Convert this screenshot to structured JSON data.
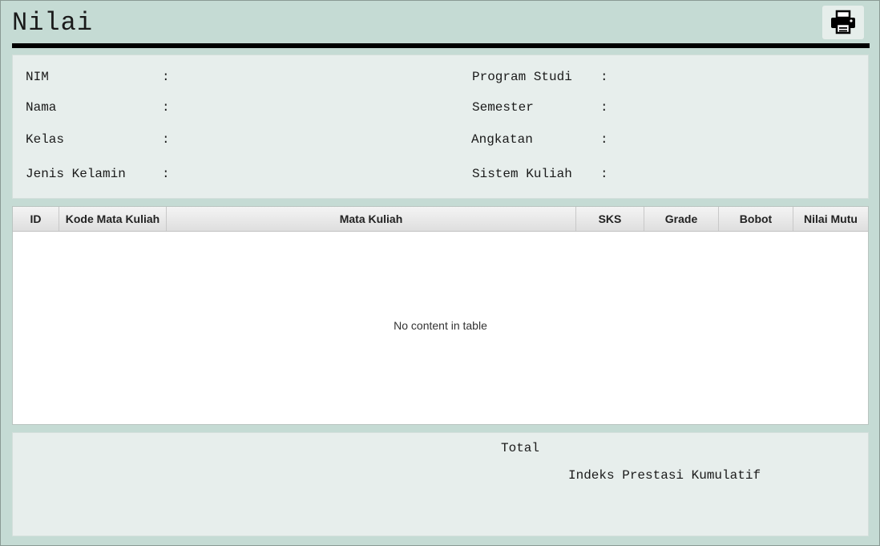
{
  "header": {
    "title": "Nilai",
    "print_icon": "printer-icon"
  },
  "info": {
    "separator": ":",
    "left": [
      {
        "label": "NIM"
      },
      {
        "label": "Nama"
      },
      {
        "label": "Kelas"
      },
      {
        "label": "Jenis Kelamin"
      }
    ],
    "right": [
      {
        "label": "Program Studi"
      },
      {
        "label": "Semester"
      },
      {
        "label": "Angkatan"
      },
      {
        "label": "Sistem Kuliah"
      }
    ]
  },
  "table": {
    "columns": [
      "ID",
      "Kode Mata Kuliah",
      "Mata Kuliah",
      "SKS",
      "Grade",
      "Bobot",
      "Nilai Mutu"
    ],
    "rows": [],
    "empty_text": "No content in table"
  },
  "summary": {
    "total_label": "Total",
    "ipk_label": "Indeks Prestasi Kumulatif"
  }
}
